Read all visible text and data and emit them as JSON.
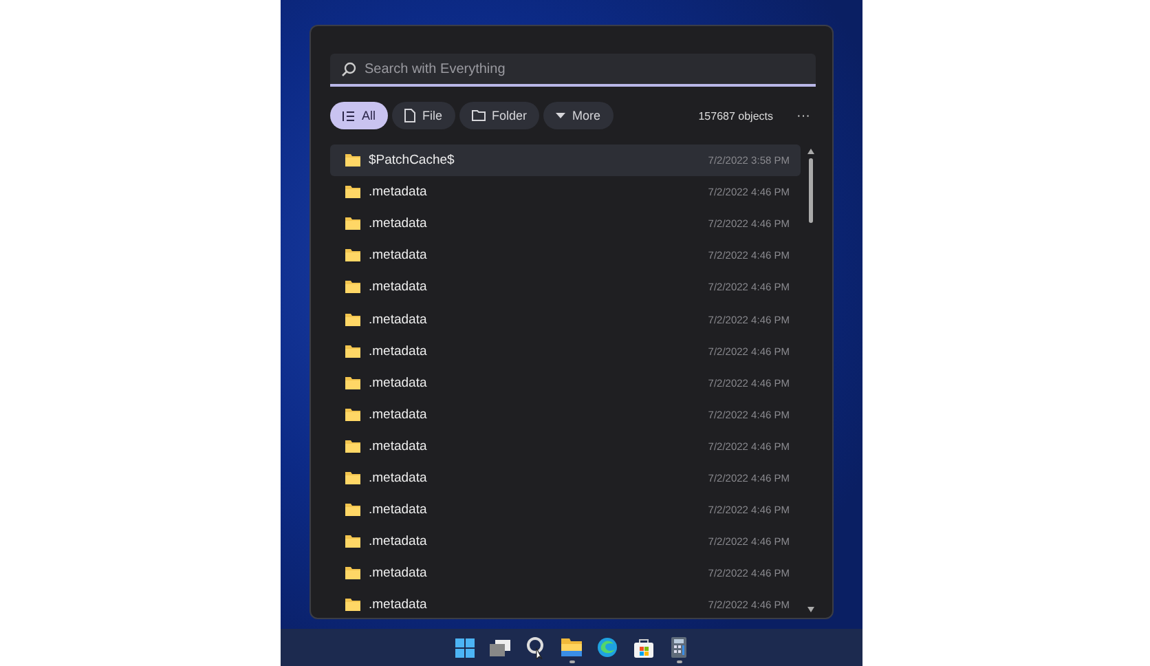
{
  "search": {
    "placeholder": "Search with Everything"
  },
  "filters": [
    {
      "label": "All",
      "kind": "list",
      "selected": true
    },
    {
      "label": "File",
      "kind": "file",
      "selected": false
    },
    {
      "label": "Folder",
      "kind": "folder",
      "selected": false
    },
    {
      "label": "More",
      "kind": "dropdown",
      "selected": false
    }
  ],
  "object_count": "157687 objects",
  "more_menu": "···",
  "results": [
    {
      "name": "$PatchCache$",
      "date": "7/2/2022 3:58 PM",
      "selected": true
    },
    {
      "name": ".metadata",
      "date": "7/2/2022 4:46 PM",
      "selected": false
    },
    {
      "name": ".metadata",
      "date": "7/2/2022 4:46 PM",
      "selected": false
    },
    {
      "name": ".metadata",
      "date": "7/2/2022 4:46 PM",
      "selected": false
    },
    {
      "name": ".metadata",
      "date": "7/2/2022 4:46 PM",
      "selected": false
    },
    {
      "name": ".metadata",
      "date": "7/2/2022 4:46 PM",
      "selected": false
    },
    {
      "name": ".metadata",
      "date": "7/2/2022 4:46 PM",
      "selected": false
    },
    {
      "name": ".metadata",
      "date": "7/2/2022 4:46 PM",
      "selected": false
    },
    {
      "name": ".metadata",
      "date": "7/2/2022 4:46 PM",
      "selected": false
    },
    {
      "name": ".metadata",
      "date": "7/2/2022 4:46 PM",
      "selected": false
    },
    {
      "name": ".metadata",
      "date": "7/2/2022 4:46 PM",
      "selected": false
    },
    {
      "name": ".metadata",
      "date": "7/2/2022 4:46 PM",
      "selected": false
    },
    {
      "name": ".metadata",
      "date": "7/2/2022 4:46 PM",
      "selected": false
    },
    {
      "name": ".metadata",
      "date": "7/2/2022 4:46 PM",
      "selected": false
    },
    {
      "name": ".metadata",
      "date": "7/2/2022 4:46 PM",
      "selected": false
    }
  ],
  "taskbar": [
    {
      "kind": "start",
      "running": false
    },
    {
      "kind": "taskview",
      "running": false
    },
    {
      "kind": "search",
      "running": false
    },
    {
      "kind": "explorer",
      "running": true
    },
    {
      "kind": "edge",
      "running": false
    },
    {
      "kind": "store",
      "running": false
    },
    {
      "kind": "calculator",
      "running": true
    }
  ]
}
